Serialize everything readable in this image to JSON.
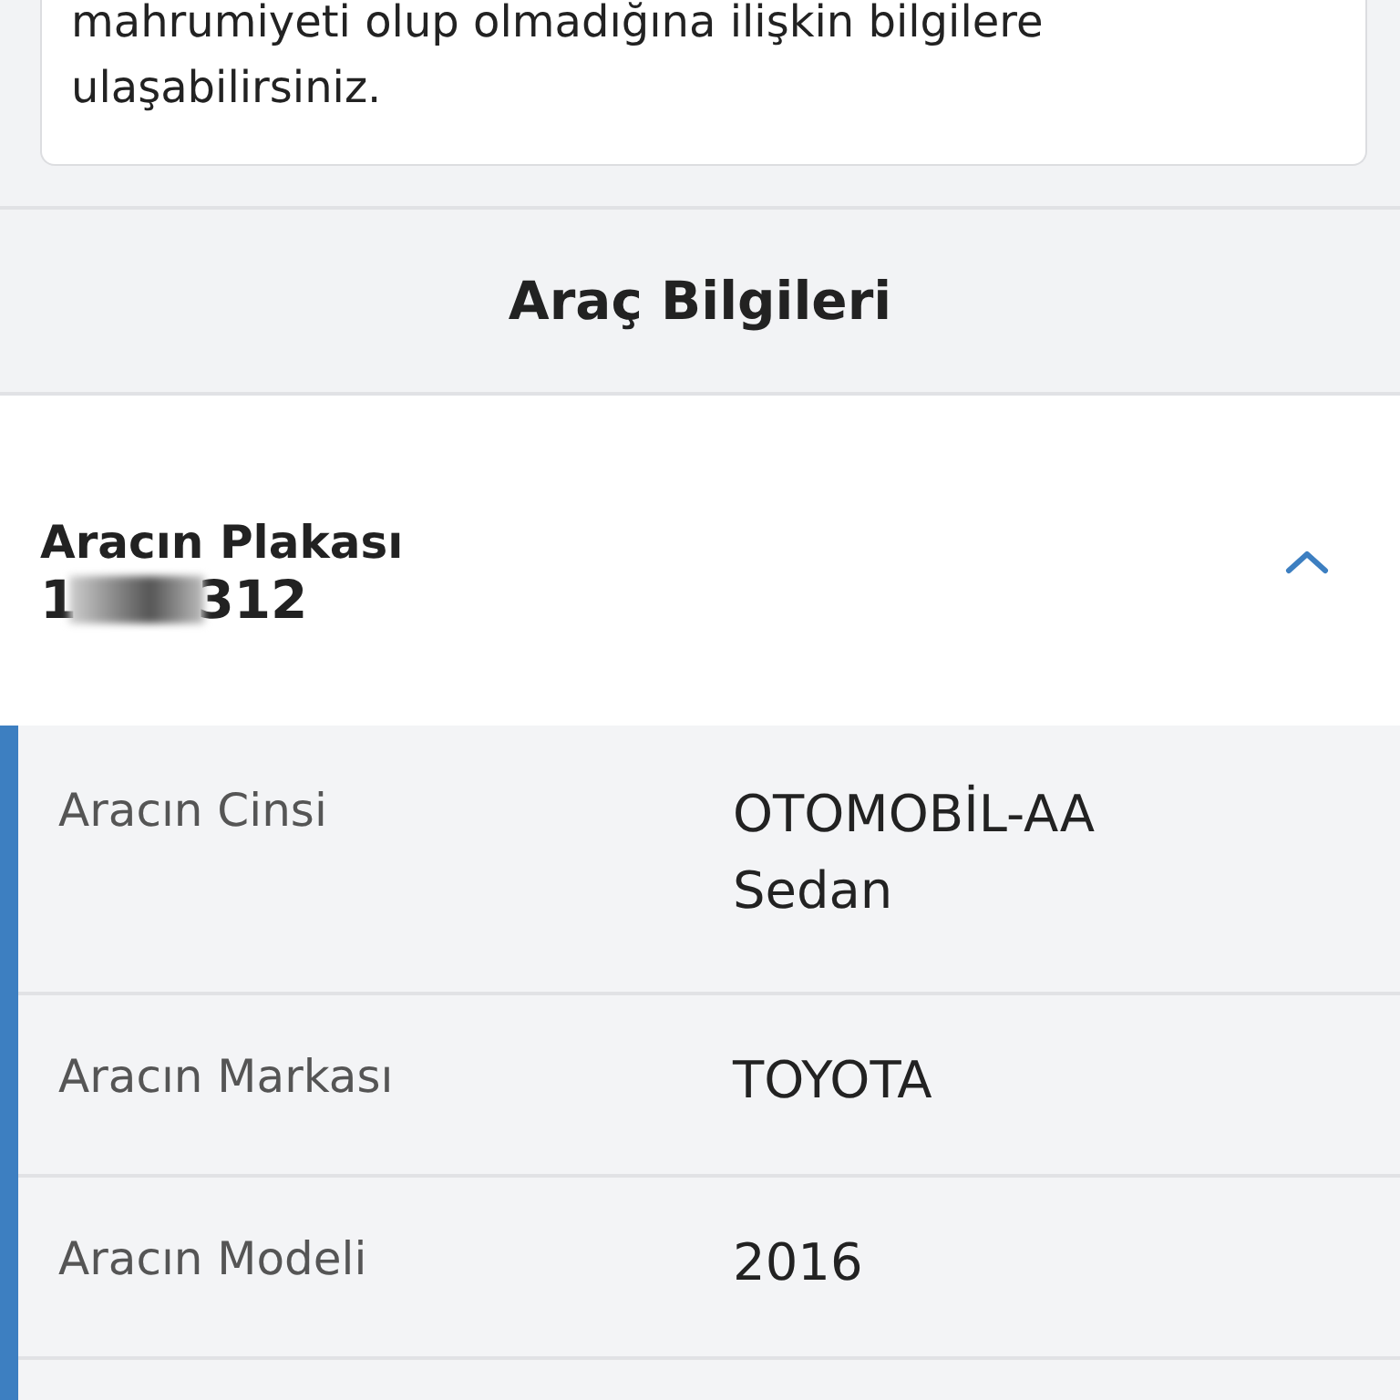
{
  "notice": {
    "text": "mahrumiyeti olup olmadığına ilişkin bilgilere ulaşabilirsiniz."
  },
  "section": {
    "title": "Araç Bilgileri"
  },
  "plate": {
    "label": "Aracın Plakası",
    "value_start": "1",
    "value_end": "312",
    "expanded": true
  },
  "details": [
    {
      "label": "Aracın Cinsi",
      "value": "OTOMOBİL-AA Sedan"
    },
    {
      "label": "Aracın Markası",
      "value": "TOYOTA"
    },
    {
      "label": "Aracın Modeli",
      "value": "2016"
    }
  ]
}
